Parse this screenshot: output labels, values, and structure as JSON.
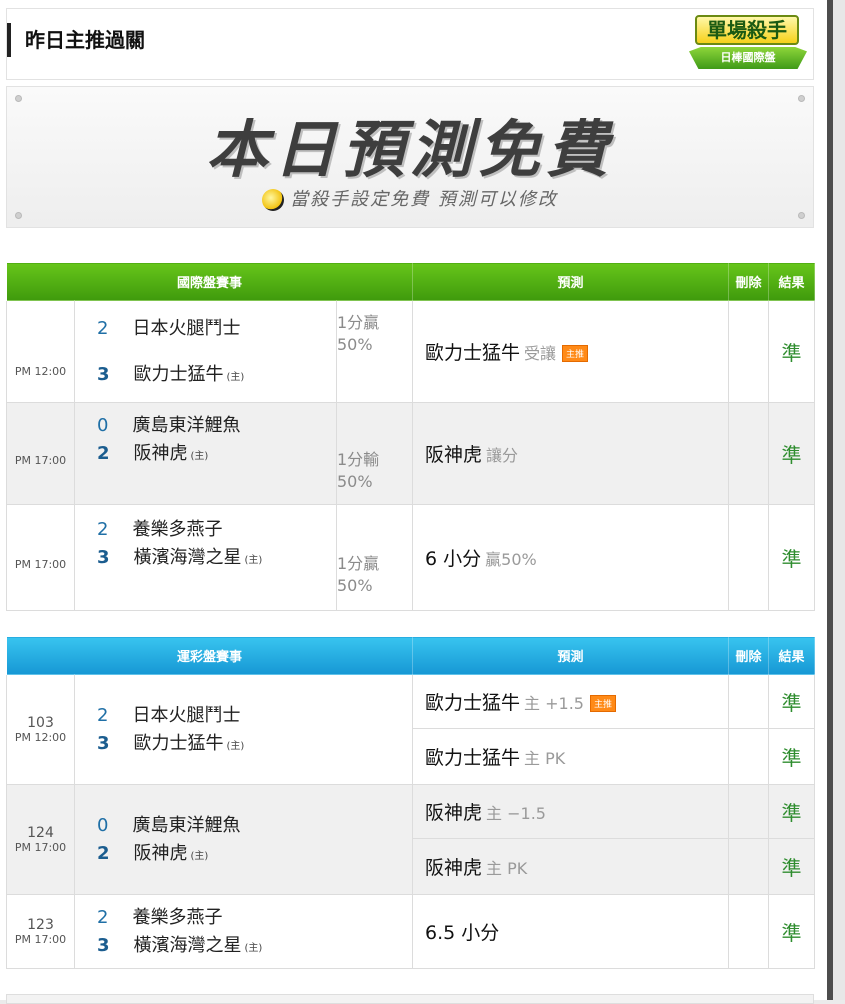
{
  "header": {
    "title": "昨日主推過關",
    "badge_top": "單場殺手",
    "badge_bottom": "日棒國際盤"
  },
  "banner": {
    "title": "本日預測免費",
    "subtitle": "當殺手設定免費 預測可以修改"
  },
  "intl_table": {
    "headers": [
      "國際盤賽事",
      "預測",
      "刪除",
      "結果"
    ],
    "rows": [
      {
        "time": "PM 12:00",
        "away_score": "2",
        "away_team": "日本火腿鬥士",
        "home_score": "3",
        "home_team": "歐力士猛牛",
        "host_mark": "(主)",
        "odds_line1": "1分贏",
        "odds_line2": "50%",
        "pred_team": "歐力士猛牛",
        "pred_detail": "受讓",
        "pred_tag": "主推",
        "result": "準"
      },
      {
        "time": "PM 17:00",
        "away_score": "0",
        "away_team": "廣島東洋鯉魚",
        "home_score": "2",
        "home_team": "阪神虎",
        "host_mark": "(主)",
        "odds_line1": "1分輸",
        "odds_line2": "50%",
        "pred_team": "阪神虎",
        "pred_detail": "讓分",
        "pred_tag": "",
        "result": "準"
      },
      {
        "time": "PM 17:00",
        "away_score": "2",
        "away_team": "養樂多燕子",
        "home_score": "3",
        "home_team": "橫濱海灣之星",
        "host_mark": "(主)",
        "odds_line1": "1分贏",
        "odds_line2": "50%",
        "pred_team": "6 小分",
        "pred_detail": "贏50%",
        "pred_tag": "",
        "result": "準"
      }
    ]
  },
  "lottery_table": {
    "headers": [
      "運彩盤賽事",
      "預測",
      "刪除",
      "結果"
    ],
    "rows": [
      {
        "code": "103",
        "time": "PM 12:00",
        "away_score": "2",
        "away_team": "日本火腿鬥士",
        "home_score": "3",
        "home_team": "歐力士猛牛",
        "host_mark": "(主)",
        "preds": [
          {
            "team": "歐力士猛牛",
            "detail": "主 +1.5",
            "tag": "主推",
            "result": "準"
          },
          {
            "team": "歐力士猛牛",
            "detail": "主 PK",
            "tag": "",
            "result": "準"
          }
        ]
      },
      {
        "code": "124",
        "time": "PM 17:00",
        "away_score": "0",
        "away_team": "廣島東洋鯉魚",
        "home_score": "2",
        "home_team": "阪神虎",
        "host_mark": "(主)",
        "preds": [
          {
            "team": "阪神虎",
            "detail": "主 −1.5",
            "tag": "",
            "result": "準"
          },
          {
            "team": "阪神虎",
            "detail": "主 PK",
            "tag": "",
            "result": "準"
          }
        ]
      },
      {
        "code": "123",
        "time": "PM 17:00",
        "away_score": "2",
        "away_team": "養樂多燕子",
        "home_score": "3",
        "home_team": "橫濱海灣之星",
        "host_mark": "(主)",
        "preds": [
          {
            "team": "6.5 小分",
            "detail": "",
            "tag": "",
            "result": "準"
          }
        ]
      }
    ]
  }
}
